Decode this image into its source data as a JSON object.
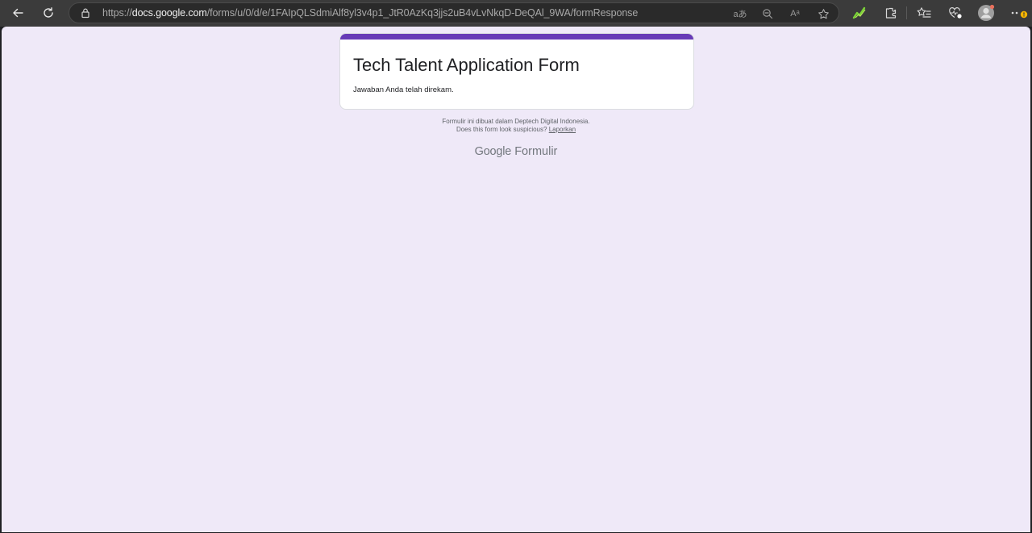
{
  "browser": {
    "url_prefix": "https://",
    "url_host": "docs.google.com",
    "url_path": "/forms/u/0/d/e/1FAIpQLSdmiAlf8yl3v4p1_JtR0AzKq3jjs2uB4vLvNkqD-DeQAl_9WA/formResponse",
    "translate_label": "aあ",
    "read_aloud_label": "Aᵃ"
  },
  "form": {
    "title": "Tech Talent Application Form",
    "confirmation": "Jawaban Anda telah direkam.",
    "accent_color": "#673ab7"
  },
  "footer": {
    "created_in": "Formulir ini dibuat dalam Deptech Digital Indonesia.",
    "suspicious_prefix": "Does this form look suspicious?",
    "report_link": "Laporkan",
    "brand_google": "Google",
    "brand_forms": "Formulir"
  }
}
